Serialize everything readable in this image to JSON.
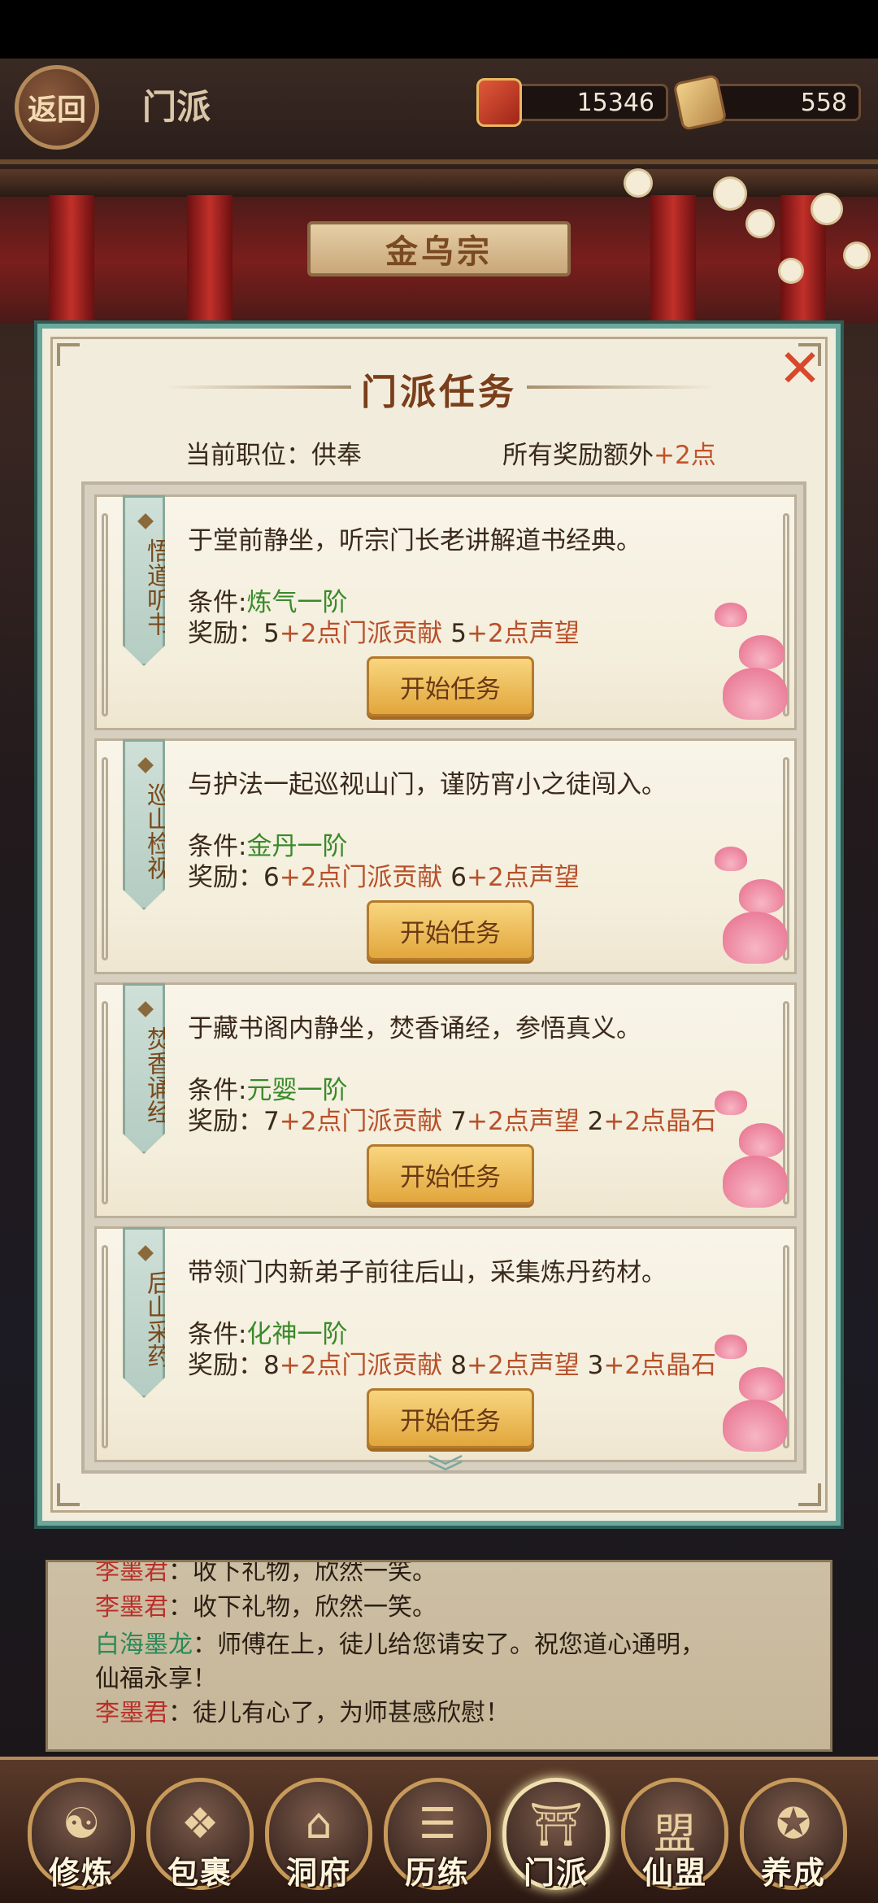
{
  "topbar": {
    "back_label": "返回",
    "title": "门派",
    "resource1": "15346",
    "resource2": "558",
    "resource1_icon": "treasure-pouch-icon",
    "resource2_icon": "scroll-icon"
  },
  "hall": {
    "sect_name": "金乌宗"
  },
  "panel": {
    "title": "门派任务",
    "close_icon": "close-icon",
    "position_label": "当前职位：",
    "position_value": "供奉",
    "bonus_label": "所有奖励额外",
    "bonus_value": "+2点"
  },
  "tasks": [
    {
      "name": "悟道听书",
      "desc": "于堂前静坐，听宗门长老讲解道书经典。",
      "cond_label": "条件:",
      "cond_value": "炼气一阶",
      "reward_label": "奖励：",
      "rewards": [
        {
          "base": "5",
          "bonus": "+2点门派贡献"
        },
        {
          "base": "5",
          "bonus": "+2点声望"
        }
      ],
      "button": "开始任务"
    },
    {
      "name": "巡山检视",
      "desc": "与护法一起巡视山门，谨防宵小之徒闯入。",
      "cond_label": "条件:",
      "cond_value": "金丹一阶",
      "reward_label": "奖励：",
      "rewards": [
        {
          "base": "6",
          "bonus": "+2点门派贡献"
        },
        {
          "base": "6",
          "bonus": "+2点声望"
        }
      ],
      "button": "开始任务"
    },
    {
      "name": "焚香诵经",
      "desc": "于藏书阁内静坐，焚香诵经，参悟真义。",
      "cond_label": "条件:",
      "cond_value": "元婴一阶",
      "reward_label": "奖励：",
      "rewards": [
        {
          "base": "7",
          "bonus": "+2点门派贡献"
        },
        {
          "base": "7",
          "bonus": "+2点声望"
        },
        {
          "base": "2",
          "bonus": "+2点晶石"
        }
      ],
      "button": "开始任务"
    },
    {
      "name": "后山采药",
      "desc": "带领门内新弟子前往后山，采集炼丹药材。",
      "cond_label": "条件:",
      "cond_value": "化神一阶",
      "reward_label": "奖励：",
      "rewards": [
        {
          "base": "8",
          "bonus": "+2点门派贡献"
        },
        {
          "base": "8",
          "bonus": "+2点声望"
        },
        {
          "base": "3",
          "bonus": "+2点晶石"
        }
      ],
      "button": "开始任务"
    }
  ],
  "chat": [
    {
      "name": "李墨君",
      "sep": "：",
      "text": "收下礼物，欣然一笑。"
    },
    {
      "name": "李墨君",
      "sep": "：",
      "text": "收下礼物，欣然一笑。"
    },
    {
      "name": "白海墨龙",
      "sep": "：",
      "text": "师傅在上，徒儿给您请安了。祝您道心通明，"
    },
    {
      "name": "",
      "sep": "",
      "text": "仙福永享！"
    },
    {
      "name": "李墨君",
      "sep": "：",
      "text": "徒儿有心了，为师甚感欣慰！"
    }
  ],
  "bottom_nav": [
    {
      "label": "修炼",
      "icon": "cultivator-icon",
      "glyph": "☯"
    },
    {
      "label": "包裹",
      "icon": "bag-icon",
      "glyph": "❖"
    },
    {
      "label": "洞府",
      "icon": "cave-house-icon",
      "glyph": "⌂"
    },
    {
      "label": "历练",
      "icon": "scroll-icon",
      "glyph": "☰"
    },
    {
      "label": "门派",
      "icon": "sect-hall-icon",
      "glyph": "⛩"
    },
    {
      "label": "仙盟",
      "icon": "alliance-icon",
      "glyph": "盟"
    },
    {
      "label": "养成",
      "icon": "pentagram-icon",
      "glyph": "✪"
    }
  ],
  "active_nav": "门派",
  "colors": {
    "accent_bonus": "#b8502a",
    "condition_green": "#3a8a2a",
    "panel_border": "#6aa89c",
    "button_gold": "#e2a63c"
  }
}
